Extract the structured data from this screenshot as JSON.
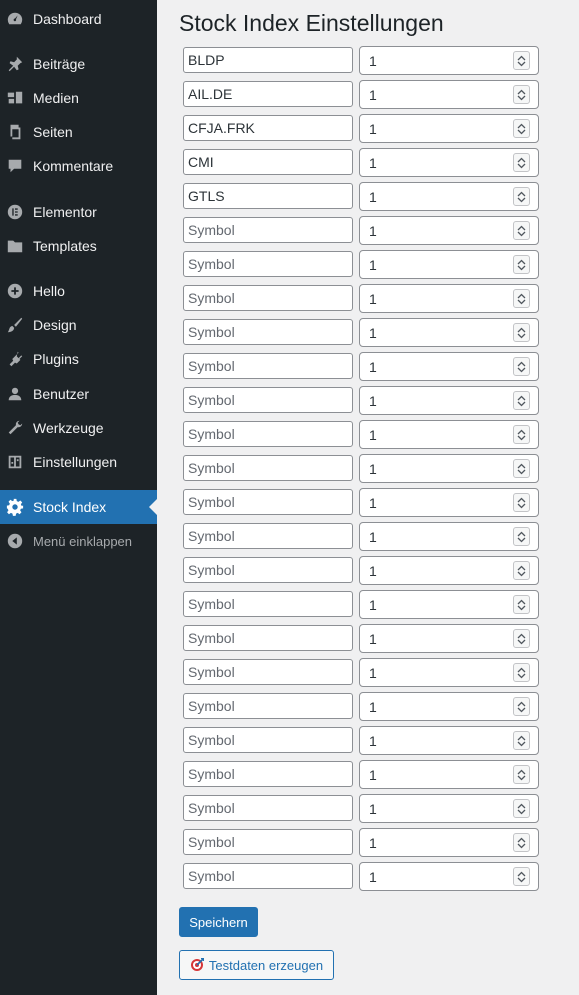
{
  "page": {
    "title": "Stock Index Einstellungen"
  },
  "sidebar": {
    "items": [
      {
        "label": "Dashboard",
        "icon": "dashboard-icon"
      },
      {
        "label": "Beiträge",
        "icon": "pin-icon"
      },
      {
        "label": "Medien",
        "icon": "media-icon"
      },
      {
        "label": "Seiten",
        "icon": "pages-icon"
      },
      {
        "label": "Kommentare",
        "icon": "comment-icon"
      },
      {
        "label": "Elementor",
        "icon": "elementor-icon"
      },
      {
        "label": "Templates",
        "icon": "folder-icon"
      },
      {
        "label": "Hello",
        "icon": "plus-circle-icon"
      },
      {
        "label": "Design",
        "icon": "brush-icon"
      },
      {
        "label": "Plugins",
        "icon": "plugin-icon"
      },
      {
        "label": "Benutzer",
        "icon": "user-icon"
      },
      {
        "label": "Werkzeuge",
        "icon": "wrench-icon"
      },
      {
        "label": "Einstellungen",
        "icon": "settings-sliders-icon"
      },
      {
        "label": "Stock Index",
        "icon": "gear-icon",
        "current": true
      },
      {
        "label": "Menü einklappen",
        "icon": "collapse-arrow-icon"
      }
    ]
  },
  "form": {
    "symbol_placeholder": "Symbol",
    "rows": [
      {
        "symbol": "BLDP",
        "weight": "1"
      },
      {
        "symbol": "AIL.DE",
        "weight": "1"
      },
      {
        "symbol": "CFJA.FRK",
        "weight": "1"
      },
      {
        "symbol": "CMI",
        "weight": "1"
      },
      {
        "symbol": "GTLS",
        "weight": "1"
      },
      {
        "symbol": "",
        "weight": "1"
      },
      {
        "symbol": "",
        "weight": "1"
      },
      {
        "symbol": "",
        "weight": "1"
      },
      {
        "symbol": "",
        "weight": "1"
      },
      {
        "symbol": "",
        "weight": "1"
      },
      {
        "symbol": "",
        "weight": "1"
      },
      {
        "symbol": "",
        "weight": "1"
      },
      {
        "symbol": "",
        "weight": "1"
      },
      {
        "symbol": "",
        "weight": "1"
      },
      {
        "symbol": "",
        "weight": "1"
      },
      {
        "symbol": "",
        "weight": "1"
      },
      {
        "symbol": "",
        "weight": "1"
      },
      {
        "symbol": "",
        "weight": "1"
      },
      {
        "symbol": "",
        "weight": "1"
      },
      {
        "symbol": "",
        "weight": "1"
      },
      {
        "symbol": "",
        "weight": "1"
      },
      {
        "symbol": "",
        "weight": "1"
      },
      {
        "symbol": "",
        "weight": "1"
      },
      {
        "symbol": "",
        "weight": "1"
      },
      {
        "symbol": "",
        "weight": "1"
      }
    ],
    "save_label": "Speichern",
    "testdata_label": "Testdaten erzeugen",
    "testdata_icon": "target-icon"
  },
  "colors": {
    "sidebar_bg": "#1d2327",
    "accent": "#2271b1",
    "page_bg": "#f0f0f1"
  }
}
